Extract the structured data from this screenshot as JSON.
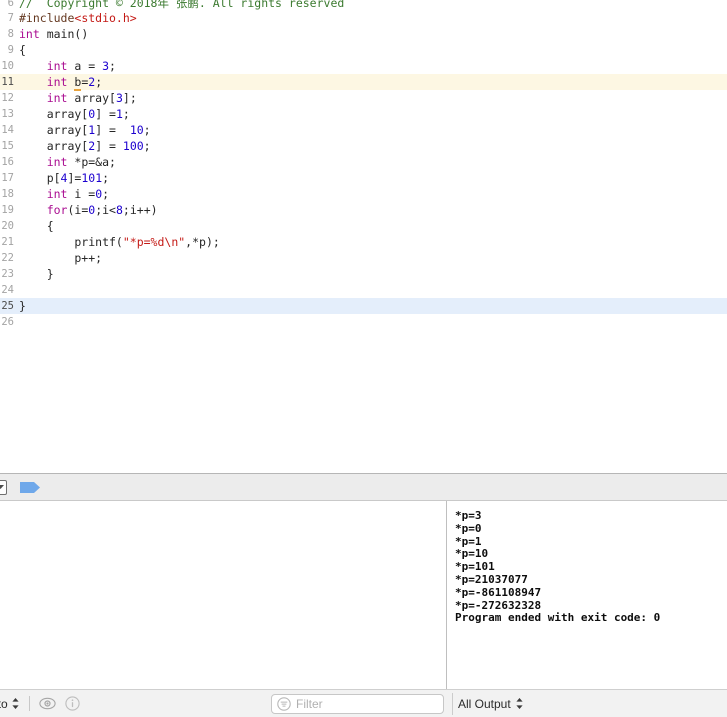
{
  "editor": {
    "first_line_number": 6,
    "lines": [
      {
        "num": "6",
        "state": "clipped",
        "tokens": [
          {
            "t": "cmt",
            "v": "//  Copyright © 2018年 张鹏. All rights reserved"
          }
        ]
      },
      {
        "num": "7",
        "state": "normal",
        "tokens": [
          {
            "t": "pre",
            "v": "#include"
          },
          {
            "t": "hdr",
            "v": "<stdio.h>"
          }
        ]
      },
      {
        "num": "8",
        "state": "normal",
        "tokens": [
          {
            "t": "kw",
            "v": "int"
          },
          {
            "t": "pln",
            "v": " main()"
          }
        ]
      },
      {
        "num": "9",
        "state": "normal",
        "tokens": [
          {
            "t": "pln",
            "v": "{"
          }
        ]
      },
      {
        "num": "10",
        "state": "normal",
        "tokens": [
          {
            "t": "pln",
            "v": "    "
          },
          {
            "t": "kw",
            "v": "int"
          },
          {
            "t": "pln",
            "v": " a = "
          },
          {
            "t": "num",
            "v": "3"
          },
          {
            "t": "pln",
            "v": ";"
          }
        ]
      },
      {
        "num": "11",
        "state": "warn",
        "tokens": [
          {
            "t": "pln",
            "v": "    "
          },
          {
            "t": "kw",
            "v": "int"
          },
          {
            "t": "pln",
            "v": " "
          },
          {
            "t": "warn",
            "v": "b"
          },
          {
            "t": "pln",
            "v": "="
          },
          {
            "t": "num",
            "v": "2"
          },
          {
            "t": "pln",
            "v": ";"
          }
        ]
      },
      {
        "num": "12",
        "state": "normal",
        "tokens": [
          {
            "t": "pln",
            "v": "    "
          },
          {
            "t": "kw",
            "v": "int"
          },
          {
            "t": "pln",
            "v": " array["
          },
          {
            "t": "num",
            "v": "3"
          },
          {
            "t": "pln",
            "v": "];"
          }
        ]
      },
      {
        "num": "13",
        "state": "normal",
        "tokens": [
          {
            "t": "pln",
            "v": "    array["
          },
          {
            "t": "num",
            "v": "0"
          },
          {
            "t": "pln",
            "v": "] ="
          },
          {
            "t": "num",
            "v": "1"
          },
          {
            "t": "pln",
            "v": ";"
          }
        ]
      },
      {
        "num": "14",
        "state": "normal",
        "tokens": [
          {
            "t": "pln",
            "v": "    array["
          },
          {
            "t": "num",
            "v": "1"
          },
          {
            "t": "pln",
            "v": "] =  "
          },
          {
            "t": "num",
            "v": "10"
          },
          {
            "t": "pln",
            "v": ";"
          }
        ]
      },
      {
        "num": "15",
        "state": "normal",
        "tokens": [
          {
            "t": "pln",
            "v": "    array["
          },
          {
            "t": "num",
            "v": "2"
          },
          {
            "t": "pln",
            "v": "] = "
          },
          {
            "t": "num",
            "v": "100"
          },
          {
            "t": "pln",
            "v": ";"
          }
        ]
      },
      {
        "num": "16",
        "state": "normal",
        "tokens": [
          {
            "t": "pln",
            "v": "    "
          },
          {
            "t": "kw",
            "v": "int"
          },
          {
            "t": "pln",
            "v": " *p=&a;"
          }
        ]
      },
      {
        "num": "17",
        "state": "normal",
        "tokens": [
          {
            "t": "pln",
            "v": "    p["
          },
          {
            "t": "num",
            "v": "4"
          },
          {
            "t": "pln",
            "v": "]="
          },
          {
            "t": "num",
            "v": "101"
          },
          {
            "t": "pln",
            "v": ";"
          }
        ]
      },
      {
        "num": "18",
        "state": "normal",
        "tokens": [
          {
            "t": "pln",
            "v": "    "
          },
          {
            "t": "kw",
            "v": "int"
          },
          {
            "t": "pln",
            "v": " i ="
          },
          {
            "t": "num",
            "v": "0"
          },
          {
            "t": "pln",
            "v": ";"
          }
        ]
      },
      {
        "num": "19",
        "state": "normal",
        "tokens": [
          {
            "t": "pln",
            "v": "    "
          },
          {
            "t": "kw",
            "v": "for"
          },
          {
            "t": "pln",
            "v": "(i="
          },
          {
            "t": "num",
            "v": "0"
          },
          {
            "t": "pln",
            "v": ";i<"
          },
          {
            "t": "num",
            "v": "8"
          },
          {
            "t": "pln",
            "v": ";i++)"
          }
        ]
      },
      {
        "num": "20",
        "state": "normal",
        "tokens": [
          {
            "t": "pln",
            "v": "    {"
          }
        ]
      },
      {
        "num": "21",
        "state": "normal",
        "tokens": [
          {
            "t": "pln",
            "v": "        printf("
          },
          {
            "t": "str",
            "v": "\"*p=%d\\n\""
          },
          {
            "t": "pln",
            "v": ",*p);"
          }
        ]
      },
      {
        "num": "22",
        "state": "normal",
        "tokens": [
          {
            "t": "pln",
            "v": "        p++;"
          }
        ]
      },
      {
        "num": "23",
        "state": "normal",
        "tokens": [
          {
            "t": "pln",
            "v": "    }"
          }
        ]
      },
      {
        "num": "24",
        "state": "normal",
        "tokens": []
      },
      {
        "num": "25",
        "state": "selected",
        "tokens": [
          {
            "t": "pln",
            "v": "}"
          }
        ]
      },
      {
        "num": "26",
        "state": "normal",
        "tokens": []
      }
    ]
  },
  "debug_bar": {
    "hide_panel_button": "hide-debug-panel",
    "flag_icon": "blue-flag-icon"
  },
  "panes": {
    "variables": {
      "content": ""
    },
    "console": {
      "lines": [
        "*p=3",
        "*p=0",
        "*p=1",
        "*p=10",
        "*p=101",
        "*p=21037077",
        "*p=-861108947",
        "*p=-272632328",
        "Program ended with exit code: 0"
      ]
    }
  },
  "status_bar": {
    "scope_label": "uto",
    "eye_icon": "eye-icon",
    "info_icon": "info-icon",
    "filter": {
      "placeholder": "Filter",
      "value": "",
      "icon": "filter-circle-icon"
    },
    "output_selector": "All Output"
  },
  "colors": {
    "comment": "#3b7a2f",
    "keyword": "#aa0d91",
    "number": "#1c00cf",
    "string": "#c41a16",
    "preprocessor": "#643820",
    "warn_line_bg": "#fdf7e3",
    "selected_line_bg": "#e4eefb",
    "warn_underline": "#e8a33d",
    "flag_blue": "#6fa8ea",
    "toolbar_bg": "#ececec",
    "statusbar_bg": "#f2f2f2"
  }
}
